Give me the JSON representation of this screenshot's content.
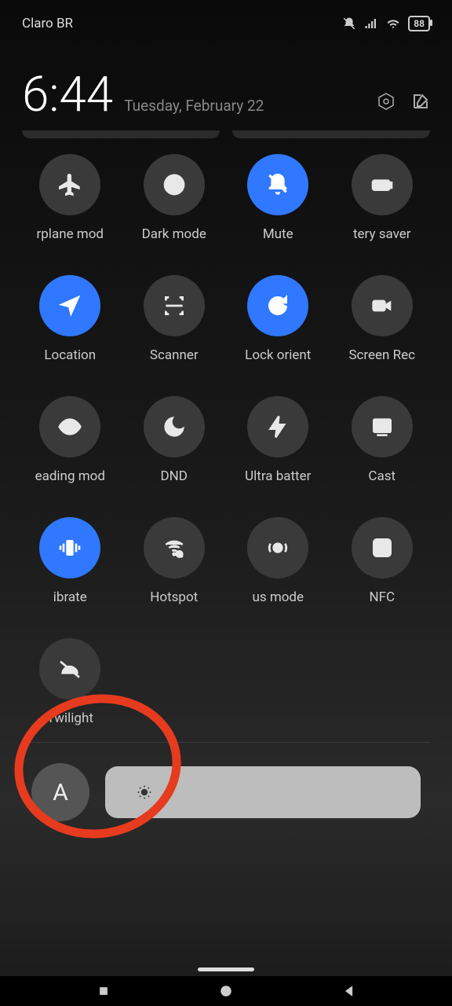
{
  "status": {
    "carrier": "Claro BR",
    "battery": "88"
  },
  "header": {
    "time": "6:44",
    "date": "Tuesday, February 22"
  },
  "tiles": [
    {
      "label": "rplane mod",
      "active": false,
      "icon": "airplane"
    },
    {
      "label": "Dark mode",
      "active": false,
      "icon": "darkmode"
    },
    {
      "label": "Mute",
      "active": true,
      "icon": "mute"
    },
    {
      "label": "tery saver",
      "active": false,
      "icon": "battery"
    },
    {
      "label": "Location",
      "active": true,
      "icon": "location"
    },
    {
      "label": "Scanner",
      "active": false,
      "icon": "scanner"
    },
    {
      "label": "Lock orient",
      "active": true,
      "icon": "lock-orient"
    },
    {
      "label": "Screen Rec",
      "active": false,
      "icon": "screenrec"
    },
    {
      "label": "eading mod",
      "active": false,
      "icon": "eye"
    },
    {
      "label": "DND",
      "active": false,
      "icon": "moon"
    },
    {
      "label": "Ultra batter",
      "active": false,
      "icon": "bolt"
    },
    {
      "label": "Cast",
      "active": false,
      "icon": "cast"
    },
    {
      "label": "ibrate",
      "active": true,
      "icon": "vibrate"
    },
    {
      "label": "Hotspot",
      "active": false,
      "icon": "hotspot"
    },
    {
      "label": "us mode",
      "active": false,
      "icon": "focus"
    },
    {
      "label": "NFC",
      "active": false,
      "icon": "nfc"
    },
    {
      "label": "Twilight",
      "active": false,
      "icon": "twilight"
    }
  ],
  "brightness": {
    "auto_label": "A"
  }
}
